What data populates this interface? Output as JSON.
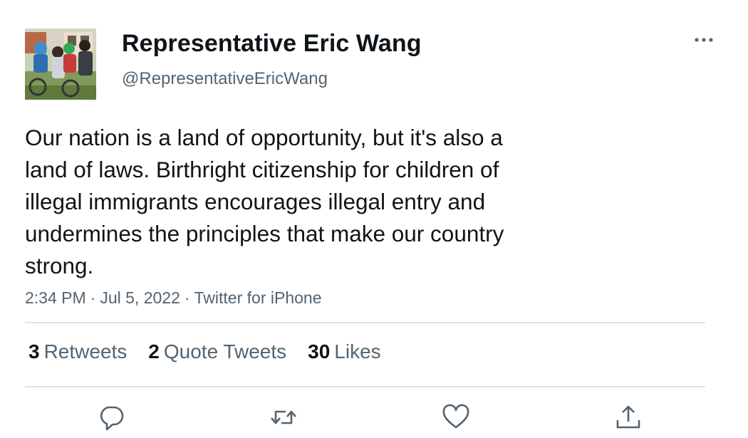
{
  "author": {
    "name": "Representative Eric Wang",
    "handle": "@RepresentativeEricWang",
    "avatar_icon": "family-photo-avatar"
  },
  "tweet": {
    "lines": [
      "Our nation is a land of opportunity, but it's also a",
      "land of laws. Birthright citizenship for children of",
      "illegal immigrants encourages illegal entry and",
      "undermines the principles that make our country",
      "strong."
    ],
    "time": "2:34 PM",
    "date": "Jul 5, 2022",
    "source": "Twitter for iPhone",
    "separator": "·"
  },
  "stats": {
    "retweets_count": "3",
    "retweets_label": "Retweets",
    "quotes_count": "2",
    "quotes_label": "Quote Tweets",
    "likes_count": "30",
    "likes_label": "Likes"
  },
  "actions": [
    "reply-icon",
    "retweet-icon",
    "like-icon",
    "share-icon"
  ],
  "colors": {
    "text": "#0f1419",
    "secondary": "#536471",
    "divider": "#e1e4e6"
  }
}
